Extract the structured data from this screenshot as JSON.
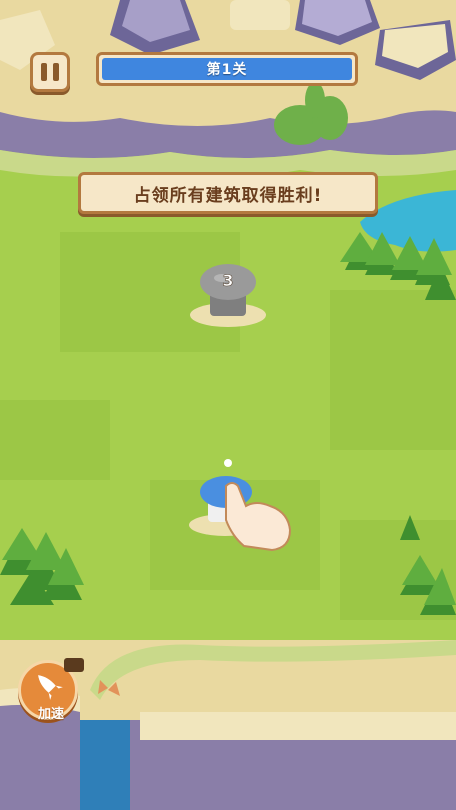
{
  "hud": {
    "level_label": "第1关",
    "objective": "占领所有建筑取得胜利!",
    "speed_button_label": "加速"
  },
  "buildings": [
    {
      "owner": "neutral",
      "color": "#9a9a9a",
      "count": "3"
    },
    {
      "owner": "player",
      "color": "#4a8fe0"
    }
  ],
  "icons": {
    "pause": "pause-icon",
    "speed": "rocket-icon",
    "video_ad": "video-camera-icon",
    "tutorial": "pointing-hand-icon"
  },
  "colors": {
    "grass": "#a6cf4e",
    "dark_grass": "#8fbe3a",
    "level_bar": "#3f86df",
    "panel": "#f6e7c8",
    "panel_border": "#b3793f",
    "water": "#3bb6d6"
  }
}
